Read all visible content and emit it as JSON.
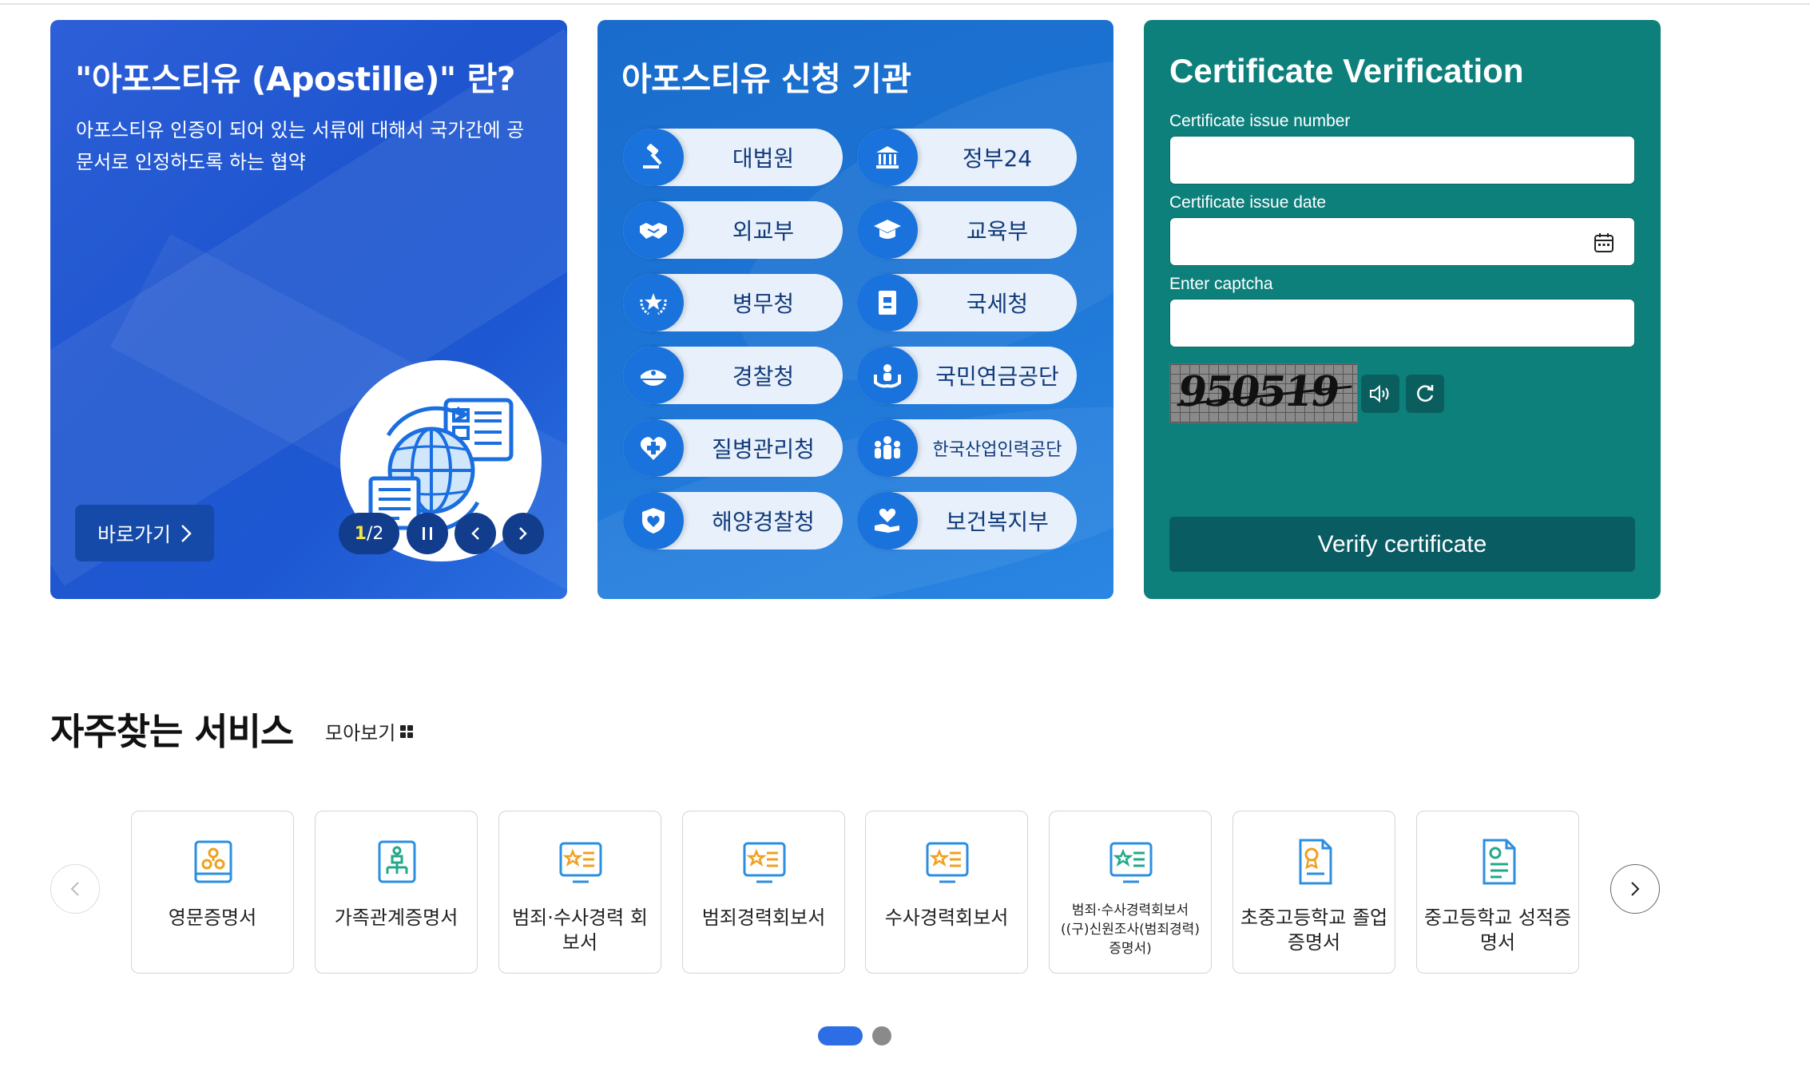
{
  "apostille_intro": {
    "title": "\"아포스티유 (Apostille)\" 란?",
    "description": "아포스티유 인증이 되어 있는 서류에 대해서 국가간에 공문서로 인정하도록 하는 협약",
    "shortcut_label": "바로가기",
    "page_current": "1",
    "page_total": "/2"
  },
  "institutions": {
    "title": "아포스티유 신청 기관",
    "items": [
      {
        "label": "대법원",
        "icon": "gavel-icon"
      },
      {
        "label": "정부24",
        "icon": "government-building-icon"
      },
      {
        "label": "외교부",
        "icon": "handshake-icon"
      },
      {
        "label": "교육부",
        "icon": "graduation-cap-icon"
      },
      {
        "label": "병무청",
        "icon": "military-emblem-icon"
      },
      {
        "label": "국세청",
        "icon": "tax-document-icon"
      },
      {
        "label": "경찰청",
        "icon": "police-cap-icon"
      },
      {
        "label": "국민연금공단",
        "icon": "hands-person-icon"
      },
      {
        "label": "질병관리청",
        "icon": "medical-cross-icon"
      },
      {
        "label": "한국산업인력공단",
        "icon": "people-group-icon"
      },
      {
        "label": "해양경찰청",
        "icon": "coast-guard-shield-icon"
      },
      {
        "label": "보건복지부",
        "icon": "heart-hand-icon"
      }
    ]
  },
  "verification": {
    "title": "Certificate Verification",
    "issue_number_label": "Certificate issue number",
    "issue_number_value": "",
    "issue_date_label": "Certificate issue date",
    "issue_date_value": "",
    "captcha_label": "Enter captcha",
    "captcha_value": "",
    "captcha_text": "950519",
    "verify_label": "Verify certificate"
  },
  "frequent_services": {
    "title": "자주찾는 서비스",
    "view_all_label": "모아보기",
    "cards": [
      {
        "label": "영문증명서",
        "icon": "english-certificate-icon"
      },
      {
        "label": "가족관계증명서",
        "icon": "family-tree-icon"
      },
      {
        "label": "범죄·수사경력 회보서",
        "icon": "criminal-record-icon"
      },
      {
        "label": "범죄경력회보서",
        "icon": "criminal-record-icon"
      },
      {
        "label": "수사경력회보서",
        "icon": "investigation-record-icon"
      },
      {
        "label": "범죄·수사경력회보서 ((구)신원조사(범죄경력)증명서)",
        "icon": "identity-record-icon"
      },
      {
        "label": "초중고등학교 졸업증명서",
        "icon": "graduation-certificate-icon"
      },
      {
        "label": "중고등학교 성적증명서",
        "icon": "transcript-icon"
      }
    ],
    "carousel_page": 1,
    "carousel_total": 2
  },
  "colors": {
    "panel_intro": "#1f56cf",
    "panel_institutions": "#1c74d4",
    "panel_verification": "#0e807c",
    "verify_button": "#0a5c63",
    "active_dot": "#2d6ee6"
  }
}
